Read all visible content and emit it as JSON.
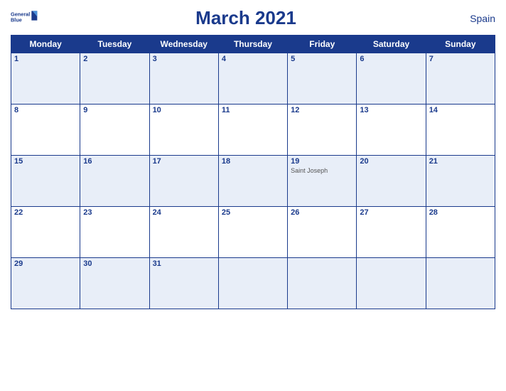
{
  "header": {
    "logo_line1": "General",
    "logo_line2": "Blue",
    "title": "March 2021",
    "country": "Spain"
  },
  "days_of_week": [
    "Monday",
    "Tuesday",
    "Wednesday",
    "Thursday",
    "Friday",
    "Saturday",
    "Sunday"
  ],
  "weeks": [
    [
      {
        "num": "1",
        "holiday": ""
      },
      {
        "num": "2",
        "holiday": ""
      },
      {
        "num": "3",
        "holiday": ""
      },
      {
        "num": "4",
        "holiday": ""
      },
      {
        "num": "5",
        "holiday": ""
      },
      {
        "num": "6",
        "holiday": ""
      },
      {
        "num": "7",
        "holiday": ""
      }
    ],
    [
      {
        "num": "8",
        "holiday": ""
      },
      {
        "num": "9",
        "holiday": ""
      },
      {
        "num": "10",
        "holiday": ""
      },
      {
        "num": "11",
        "holiday": ""
      },
      {
        "num": "12",
        "holiday": ""
      },
      {
        "num": "13",
        "holiday": ""
      },
      {
        "num": "14",
        "holiday": ""
      }
    ],
    [
      {
        "num": "15",
        "holiday": ""
      },
      {
        "num": "16",
        "holiday": ""
      },
      {
        "num": "17",
        "holiday": ""
      },
      {
        "num": "18",
        "holiday": ""
      },
      {
        "num": "19",
        "holiday": "Saint Joseph"
      },
      {
        "num": "20",
        "holiday": ""
      },
      {
        "num": "21",
        "holiday": ""
      }
    ],
    [
      {
        "num": "22",
        "holiday": ""
      },
      {
        "num": "23",
        "holiday": ""
      },
      {
        "num": "24",
        "holiday": ""
      },
      {
        "num": "25",
        "holiday": ""
      },
      {
        "num": "26",
        "holiday": ""
      },
      {
        "num": "27",
        "holiday": ""
      },
      {
        "num": "28",
        "holiday": ""
      }
    ],
    [
      {
        "num": "29",
        "holiday": ""
      },
      {
        "num": "30",
        "holiday": ""
      },
      {
        "num": "31",
        "holiday": ""
      },
      {
        "num": "",
        "holiday": ""
      },
      {
        "num": "",
        "holiday": ""
      },
      {
        "num": "",
        "holiday": ""
      },
      {
        "num": "",
        "holiday": ""
      }
    ]
  ]
}
